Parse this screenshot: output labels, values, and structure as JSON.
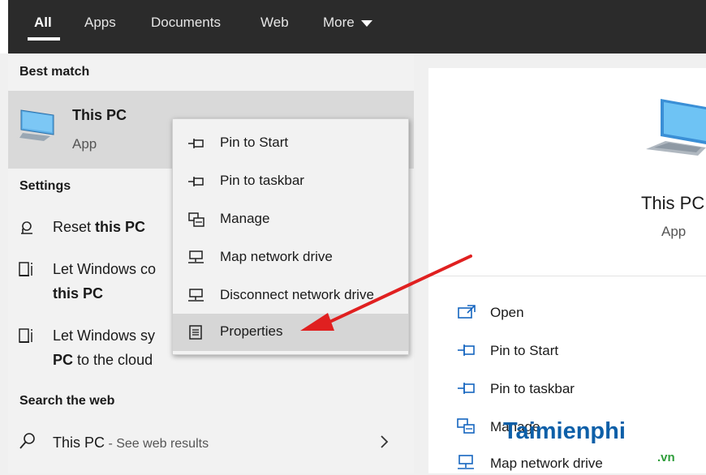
{
  "tabs": [
    "All",
    "Apps",
    "Documents",
    "Web",
    "More"
  ],
  "sections": {
    "best_match": "Best match",
    "settings": "Settings",
    "search_web": "Search the web"
  },
  "best_match": {
    "title": "This PC",
    "subtitle": "App"
  },
  "settings_items": [
    {
      "pre": "Reset ",
      "bold": "this PC",
      "line2": ""
    },
    {
      "pre": "Let Windows co",
      "bold": "",
      "line2_bold": "this PC",
      "line2": ""
    },
    {
      "pre": "Let Windows sy",
      "bold": "",
      "line2_bold": "PC",
      "line2": " to the cloud"
    }
  ],
  "web": {
    "query": "This PC",
    "suffix": " - See web results"
  },
  "context_menu": [
    {
      "label": "Pin to Start",
      "icon": "pin-icon"
    },
    {
      "label": "Pin to taskbar",
      "icon": "pin-icon"
    },
    {
      "label": "Manage",
      "icon": "manage-icon"
    },
    {
      "label": "Map network drive",
      "icon": "network-drive-icon"
    },
    {
      "label": "Disconnect network drive",
      "icon": "network-drive-icon"
    },
    {
      "label": "Properties",
      "icon": "properties-icon"
    }
  ],
  "right_panel": {
    "title": "This PC",
    "subtitle": "App",
    "actions": [
      "Open",
      "Pin to Start",
      "Pin to taskbar",
      "Manage",
      "Map network drive"
    ]
  },
  "watermark": {
    "main": "Taimienphi",
    "suffix": ".vn"
  },
  "colors": {
    "accent": "#1565c0",
    "arrow": "#e02020",
    "topbar": "#2b2b2b"
  }
}
